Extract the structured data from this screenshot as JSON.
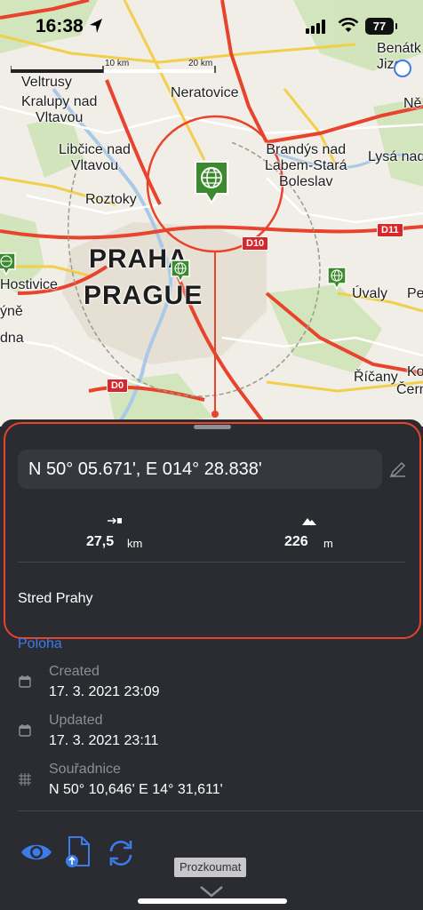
{
  "status_bar": {
    "time": "16:38",
    "battery": "77"
  },
  "map": {
    "scale_labels": [
      "10 km",
      "20 km"
    ],
    "place_labels": [
      {
        "id": "veltrusy",
        "text": "Veltrusy"
      },
      {
        "id": "kralupy",
        "text": "Kralupy nad\nVltavou"
      },
      {
        "id": "neratovice",
        "text": "Neratovice"
      },
      {
        "id": "benatky",
        "text": "Benátk\nJize"
      },
      {
        "id": "libcice",
        "text": "Libčice nad\nVltavou"
      },
      {
        "id": "roztoky",
        "text": "Roztoky"
      },
      {
        "id": "brandys",
        "text": "Brandýs nad\nLabem-Stará\nBoleslav"
      },
      {
        "id": "lysa",
        "text": "Lysá nad"
      },
      {
        "id": "praha",
        "text": "PRAHA"
      },
      {
        "id": "prague",
        "text": "PRAGUE"
      },
      {
        "id": "hostivice",
        "text": "Hostivice"
      },
      {
        "id": "yne",
        "text": "ýně"
      },
      {
        "id": "dna",
        "text": "dna"
      },
      {
        "id": "uvaly",
        "text": "Úvaly"
      },
      {
        "id": "ricany",
        "text": "Říčany"
      },
      {
        "id": "pe",
        "text": "Pe"
      },
      {
        "id": "ne",
        "text": "Ně"
      },
      {
        "id": "ko",
        "text": "Ko"
      },
      {
        "id": "cern",
        "text": "Čern"
      }
    ],
    "road_badges": [
      "D10",
      "D11",
      "D0"
    ]
  },
  "sheet": {
    "coordinates": "N 50° 05.671', E 014° 28.838'",
    "distance": {
      "value": "27,5",
      "unit": "km"
    },
    "elevation": {
      "value": "226",
      "unit": "m"
    },
    "place_name": "Stred Prahy",
    "section_title": "Poloha",
    "info": [
      {
        "label": "Created",
        "value": "17. 3. 2021 23:09",
        "icon": "calendar-icon"
      },
      {
        "label": "Updated",
        "value": "17. 3. 2021 23:11",
        "icon": "calendar-icon"
      },
      {
        "label": "Souřadnice",
        "value": "N 50° 10,646' E 14° 31,611'",
        "icon": "grid-icon"
      }
    ],
    "tooltip": "Prozkoumat"
  },
  "colors": {
    "accent_blue": "#3d7be8",
    "highlight_red": "#e8432c",
    "sheet_bg": "#2a2c31",
    "poi_green": "#3b8a2e"
  }
}
